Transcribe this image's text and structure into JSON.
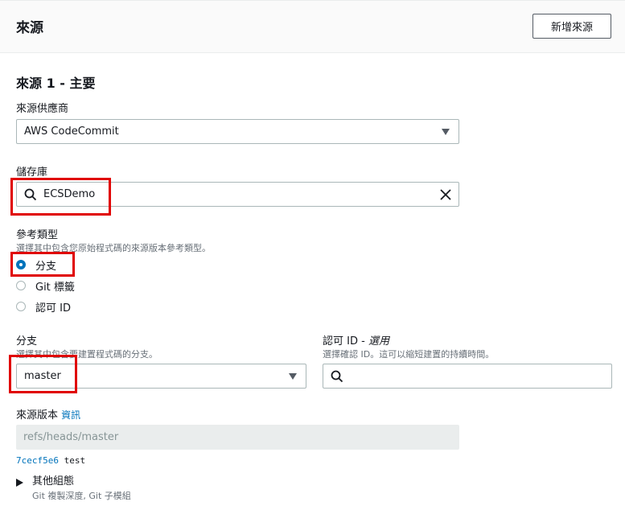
{
  "header": {
    "title": "來源",
    "add_button": "新增來源"
  },
  "section": {
    "title": "來源 1 - 主要"
  },
  "provider": {
    "label": "來源供應商",
    "value": "AWS CodeCommit"
  },
  "repository": {
    "label": "儲存庫",
    "value": "ECSDemo"
  },
  "reference_type": {
    "label": "參考類型",
    "description": "選擇其中包含您原始程式碼的來源版本參考類型。",
    "options": [
      {
        "label": "分支",
        "selected": true
      },
      {
        "label": "Git 標籤",
        "selected": false
      },
      {
        "label": "認可 ID",
        "selected": false
      }
    ]
  },
  "branch": {
    "label": "分支",
    "description": "選擇其中包含要建置程式碼的分支。",
    "value": "master"
  },
  "commit_id": {
    "label": "認可 ID - ",
    "label_optional": "選用",
    "description": "選擇確認 ID。這可以縮短建置的持續時間。",
    "value": ""
  },
  "source_version": {
    "label": "來源版本",
    "info_link": "資訊",
    "value": "refs/heads/master",
    "commit_hash": "7cecf5e6",
    "commit_message": "test"
  },
  "additional_config": {
    "label": "其他組態",
    "description": "Git 複製深度, Git 子模組"
  },
  "colors": {
    "accent": "#0073bb",
    "highlight": "#e00000",
    "border": "#aab7b8"
  }
}
